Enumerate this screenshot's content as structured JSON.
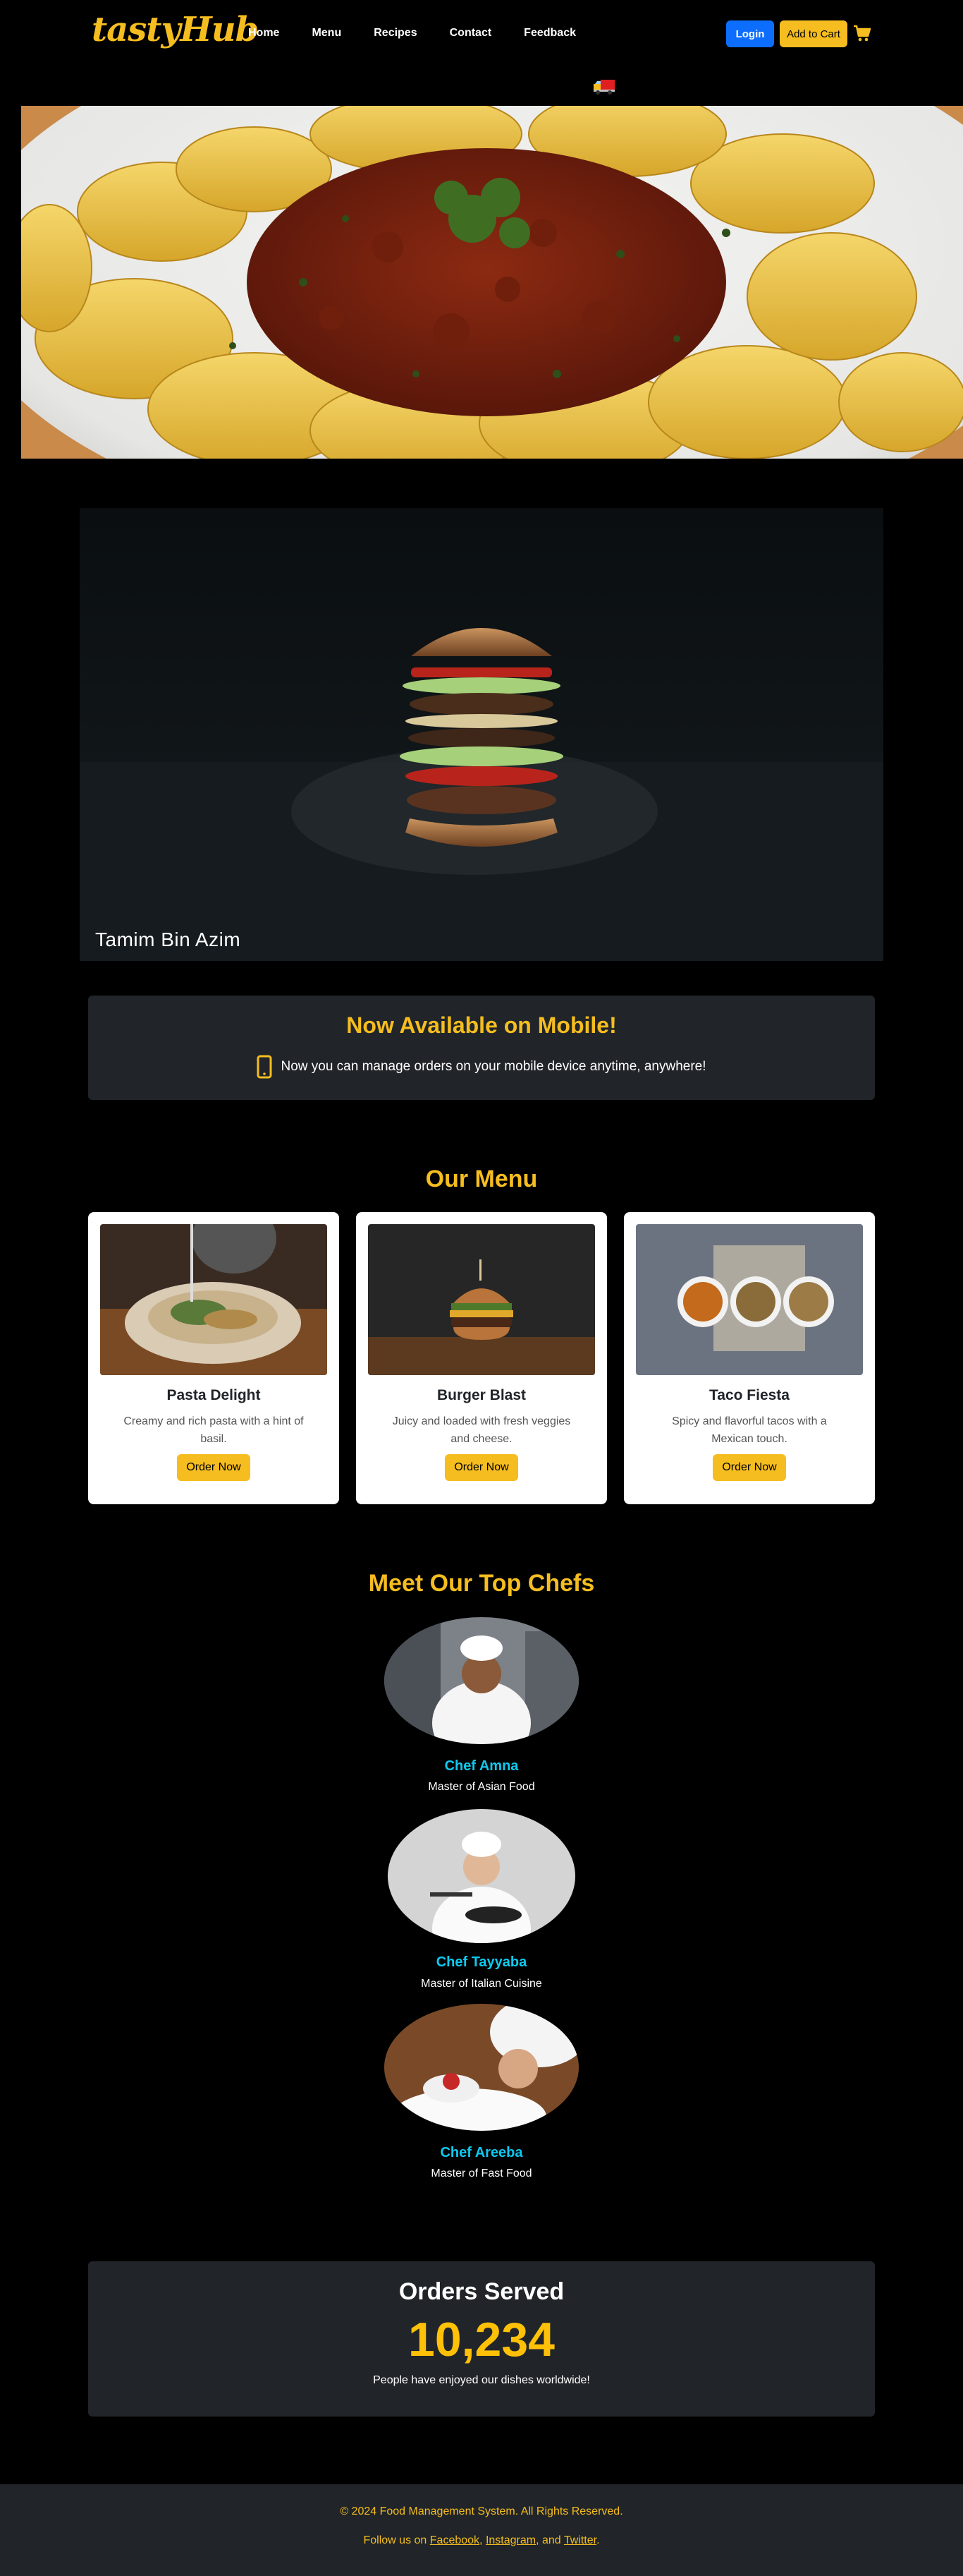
{
  "nav": {
    "brand": "tastyHub",
    "links": [
      "Home",
      "Menu",
      "Recipes",
      "Contact",
      "Feedback"
    ],
    "login_label": "Login",
    "cart_label": "Add to Cart",
    "cart_icon": "shopping-cart-icon",
    "delivery_icon": "delivery-truck-icon"
  },
  "banner": {
    "caption": "Tamim Bin Azim"
  },
  "mobile": {
    "title": "Now Available on Mobile!",
    "text": "Now you can manage orders on your mobile device anytime, anywhere!",
    "icon": "mobile-phone-icon"
  },
  "menu": {
    "title": "Our Menu",
    "items": [
      {
        "name": "Pasta Delight",
        "description": "Creamy and rich pasta with a hint of basil.",
        "button": "Order Now"
      },
      {
        "name": "Burger Blast",
        "description": "Juicy and loaded with fresh veggies and cheese.",
        "button": "Order Now"
      },
      {
        "name": "Taco Fiesta",
        "description": "Spicy and flavorful tacos with a Mexican touch.",
        "button": "Order Now"
      }
    ]
  },
  "chefs": {
    "title": "Meet Our Top Chefs",
    "items": [
      {
        "name": "Chef Amna",
        "role": "Master of Asian Food"
      },
      {
        "name": "Chef Tayyaba",
        "role": "Master of Italian Cuisine"
      },
      {
        "name": "Chef Areeba",
        "role": "Master of Fast Food"
      }
    ]
  },
  "orders": {
    "title": "Orders Served",
    "count": "10,234",
    "text": "People have enjoyed our dishes worldwide!"
  },
  "footer": {
    "copyright": "© 2024 Food Management System. All Rights Reserved.",
    "follow_prefix": "Follow us on",
    "links": [
      "Facebook",
      "Instagram",
      "Twitter"
    ],
    "sep1": ",",
    "sep2": ", and",
    "end": "."
  },
  "colors": {
    "accent": "#f5bd1f",
    "primary": "#0d6efd",
    "chef_name": "#0dcaf0",
    "panel": "#212529"
  }
}
